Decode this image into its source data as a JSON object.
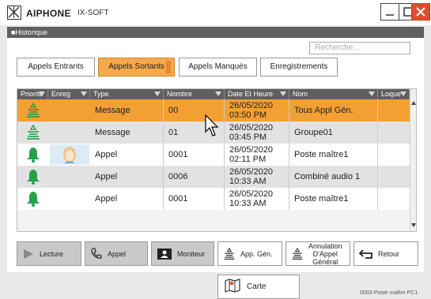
{
  "window": {
    "brand": "AIPHONE",
    "product": "IX-SOFT",
    "section_title": "■Historique",
    "colors": {
      "accent": "#f2a033",
      "header": "#5f5f5f",
      "close": "#e04c2c",
      "bell": "#23a24a"
    }
  },
  "search": {
    "placeholder": "Recherche..."
  },
  "tabs": [
    {
      "label": "Appels Entrants",
      "active": false
    },
    {
      "label": "Appels Sortants",
      "active": true
    },
    {
      "label": "Appels Manqués",
      "active": false
    },
    {
      "label": "Enregistrements",
      "active": false
    }
  ],
  "table": {
    "columns": [
      "Priorité",
      "Enreg",
      "Type",
      "Nombre",
      "Date Et Heure",
      "Nom",
      "Loque"
    ],
    "rows": [
      {
        "priority_icon": "broadcast-icon",
        "recording": false,
        "type": "Message",
        "number": "00",
        "date": "26/05/2020",
        "time": "03:50 PM",
        "name": "Tous Appl Gén.",
        "selected": true
      },
      {
        "priority_icon": "broadcast-icon",
        "recording": false,
        "type": "Message",
        "number": "01",
        "date": "26/05/2020",
        "time": "03:45 PM",
        "name": "Groupe01",
        "selected": false
      },
      {
        "priority_icon": "bell-icon",
        "recording": true,
        "type": "Appel",
        "number": "0001",
        "date": "26/05/2020",
        "time": "02:11 PM",
        "name": "Poste maître1",
        "selected": false
      },
      {
        "priority_icon": "bell-icon",
        "recording": false,
        "type": "Appel",
        "number": "0006",
        "date": "26/05/2020",
        "time": "10:33 AM",
        "name": "Combiné audio 1",
        "selected": false
      },
      {
        "priority_icon": "bell-icon",
        "recording": false,
        "type": "Appel",
        "number": "0001",
        "date": "26/05/2020",
        "time": "10:33 AM",
        "name": "Poste maître1",
        "selected": false
      }
    ]
  },
  "actions": {
    "lecture": "Lecture",
    "appel": "Appel",
    "moniteur": "Moniteur",
    "app_gen": "App. Gén.",
    "annulation_1": "Annulation",
    "annulation_2": "D'Appel",
    "annulation_3": "Général",
    "retour": "Retour",
    "carte": "Carte"
  },
  "footer": {
    "station_id": "0003-Poste maître PC1"
  }
}
